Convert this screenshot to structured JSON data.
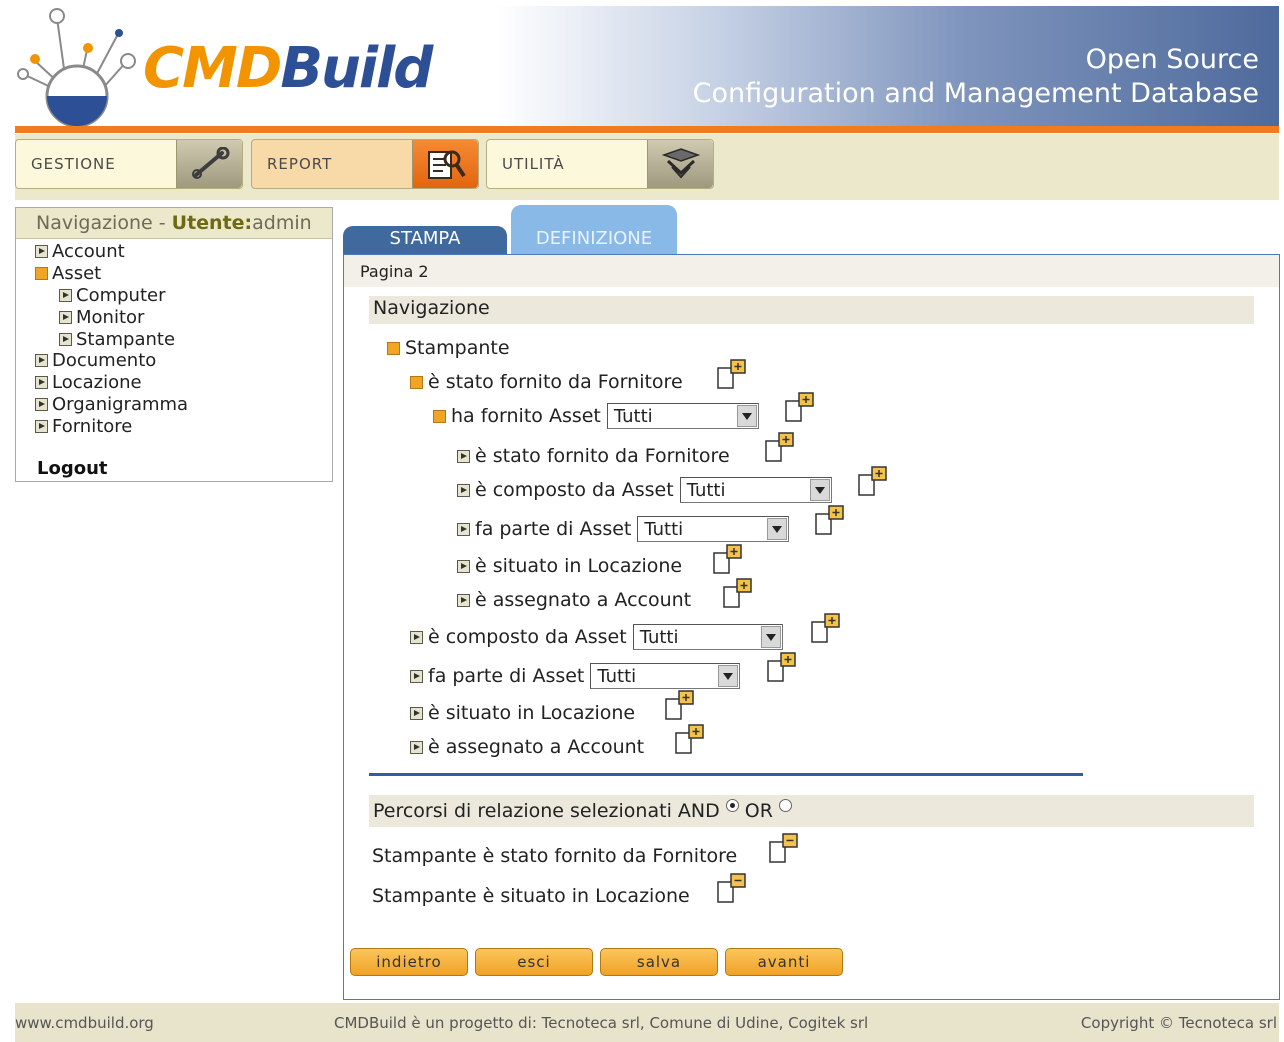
{
  "header": {
    "logo_part1": "CMD",
    "logo_part2": "Build",
    "tagline_line1": "Open Source",
    "tagline_line2": "Configuration and Management Database"
  },
  "menu": {
    "gestione": "GESTIONE",
    "report": "REPORT",
    "utilita": "UTILITÀ"
  },
  "left_panel": {
    "title_prefix": "Navigazione - ",
    "user_label": "Utente:",
    "user_name": "admin",
    "tree": [
      "Account",
      "Asset",
      "Computer",
      "Monitor",
      "Stampante",
      "Documento",
      "Locazione",
      "Organigramma",
      "Fornitore"
    ],
    "logout": "Logout"
  },
  "tabs": {
    "stampa": "STAMPA",
    "definizione": "DEFINIZIONE"
  },
  "main": {
    "page_label": "Pagina 2",
    "nav_header": "Navigazione",
    "tree": [
      {
        "label": "Stampante"
      },
      {
        "label": "è stato fornito da Fornitore"
      },
      {
        "label": "ha fornito Asset",
        "select": "Tutti"
      },
      {
        "label": "è stato fornito da Fornitore"
      },
      {
        "label": "è composto da Asset",
        "select": "Tutti"
      },
      {
        "label": "fa parte di Asset",
        "select": "Tutti"
      },
      {
        "label": "è situato in Locazione"
      },
      {
        "label": "è assegnato a Account"
      },
      {
        "label": "è composto da Asset",
        "select": "Tutti"
      },
      {
        "label": "fa parte di Asset",
        "select": "Tutti"
      },
      {
        "label": "è situato in Locazione"
      },
      {
        "label": "è assegnato a Account"
      }
    ],
    "paths_header": "Percorsi di relazione selezionati AND",
    "or_label": "OR",
    "selected_paths": [
      "Stampante è stato fornito da Fornitore",
      "Stampante è situato in Locazione"
    ],
    "buttons": {
      "back": "indietro",
      "exit": "esci",
      "save": "salva",
      "next": "avanti"
    }
  },
  "footer": {
    "site": "www.cmdbuild.org",
    "project": "CMDBuild è un progetto di: Tecnoteca srl, Comune di Udine, Cogitek srl",
    "copyright": "Copyright © Tecnoteca srl"
  }
}
